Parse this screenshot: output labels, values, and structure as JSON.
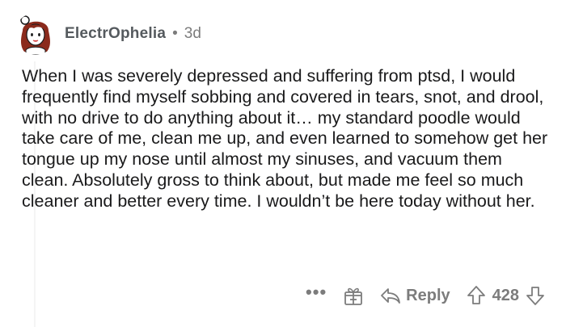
{
  "comment": {
    "author": "ElectrOphelia",
    "separator": "•",
    "age": "3d",
    "body": "When I was severely depressed and suffering from ptsd, I would frequently find myself sobbing and covered in tears, snot, and drool, with no drive to do anything about it… my standard poodle would take care of me, clean me up, and even learned to somehow get her tongue up my nose until almost my sinuses, and vacuum them clean. Absolutely gross to think about, but made me feel so much cleaner and better every time. I wouldn’t be here today without her.",
    "actions": {
      "more_label": "•••",
      "award_icon": "gift-icon",
      "reply_icon": "reply-arrow-icon",
      "reply_label": "Reply",
      "upvote_icon": "upvote-arrow-icon",
      "score": "428",
      "downvote_icon": "downvote-arrow-icon"
    }
  },
  "colors": {
    "text": "#1a1a1b",
    "meta": "#7c7c7c",
    "username": "#555a5e",
    "avatar_hair": "#8b2a1c",
    "avatar_lips": "#d23b3b"
  }
}
